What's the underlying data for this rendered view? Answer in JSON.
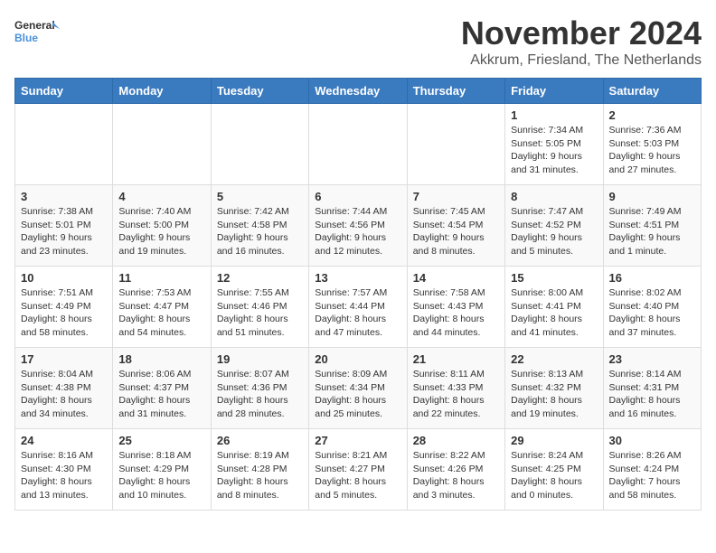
{
  "header": {
    "logo_general": "General",
    "logo_blue": "Blue",
    "month_year": "November 2024",
    "location": "Akkrum, Friesland, The Netherlands"
  },
  "weekdays": [
    "Sunday",
    "Monday",
    "Tuesday",
    "Wednesday",
    "Thursday",
    "Friday",
    "Saturday"
  ],
  "weeks": [
    [
      {
        "day": "",
        "info": ""
      },
      {
        "day": "",
        "info": ""
      },
      {
        "day": "",
        "info": ""
      },
      {
        "day": "",
        "info": ""
      },
      {
        "day": "",
        "info": ""
      },
      {
        "day": "1",
        "info": "Sunrise: 7:34 AM\nSunset: 5:05 PM\nDaylight: 9 hours and 31 minutes."
      },
      {
        "day": "2",
        "info": "Sunrise: 7:36 AM\nSunset: 5:03 PM\nDaylight: 9 hours and 27 minutes."
      }
    ],
    [
      {
        "day": "3",
        "info": "Sunrise: 7:38 AM\nSunset: 5:01 PM\nDaylight: 9 hours and 23 minutes."
      },
      {
        "day": "4",
        "info": "Sunrise: 7:40 AM\nSunset: 5:00 PM\nDaylight: 9 hours and 19 minutes."
      },
      {
        "day": "5",
        "info": "Sunrise: 7:42 AM\nSunset: 4:58 PM\nDaylight: 9 hours and 16 minutes."
      },
      {
        "day": "6",
        "info": "Sunrise: 7:44 AM\nSunset: 4:56 PM\nDaylight: 9 hours and 12 minutes."
      },
      {
        "day": "7",
        "info": "Sunrise: 7:45 AM\nSunset: 4:54 PM\nDaylight: 9 hours and 8 minutes."
      },
      {
        "day": "8",
        "info": "Sunrise: 7:47 AM\nSunset: 4:52 PM\nDaylight: 9 hours and 5 minutes."
      },
      {
        "day": "9",
        "info": "Sunrise: 7:49 AM\nSunset: 4:51 PM\nDaylight: 9 hours and 1 minute."
      }
    ],
    [
      {
        "day": "10",
        "info": "Sunrise: 7:51 AM\nSunset: 4:49 PM\nDaylight: 8 hours and 58 minutes."
      },
      {
        "day": "11",
        "info": "Sunrise: 7:53 AM\nSunset: 4:47 PM\nDaylight: 8 hours and 54 minutes."
      },
      {
        "day": "12",
        "info": "Sunrise: 7:55 AM\nSunset: 4:46 PM\nDaylight: 8 hours and 51 minutes."
      },
      {
        "day": "13",
        "info": "Sunrise: 7:57 AM\nSunset: 4:44 PM\nDaylight: 8 hours and 47 minutes."
      },
      {
        "day": "14",
        "info": "Sunrise: 7:58 AM\nSunset: 4:43 PM\nDaylight: 8 hours and 44 minutes."
      },
      {
        "day": "15",
        "info": "Sunrise: 8:00 AM\nSunset: 4:41 PM\nDaylight: 8 hours and 41 minutes."
      },
      {
        "day": "16",
        "info": "Sunrise: 8:02 AM\nSunset: 4:40 PM\nDaylight: 8 hours and 37 minutes."
      }
    ],
    [
      {
        "day": "17",
        "info": "Sunrise: 8:04 AM\nSunset: 4:38 PM\nDaylight: 8 hours and 34 minutes."
      },
      {
        "day": "18",
        "info": "Sunrise: 8:06 AM\nSunset: 4:37 PM\nDaylight: 8 hours and 31 minutes."
      },
      {
        "day": "19",
        "info": "Sunrise: 8:07 AM\nSunset: 4:36 PM\nDaylight: 8 hours and 28 minutes."
      },
      {
        "day": "20",
        "info": "Sunrise: 8:09 AM\nSunset: 4:34 PM\nDaylight: 8 hours and 25 minutes."
      },
      {
        "day": "21",
        "info": "Sunrise: 8:11 AM\nSunset: 4:33 PM\nDaylight: 8 hours and 22 minutes."
      },
      {
        "day": "22",
        "info": "Sunrise: 8:13 AM\nSunset: 4:32 PM\nDaylight: 8 hours and 19 minutes."
      },
      {
        "day": "23",
        "info": "Sunrise: 8:14 AM\nSunset: 4:31 PM\nDaylight: 8 hours and 16 minutes."
      }
    ],
    [
      {
        "day": "24",
        "info": "Sunrise: 8:16 AM\nSunset: 4:30 PM\nDaylight: 8 hours and 13 minutes."
      },
      {
        "day": "25",
        "info": "Sunrise: 8:18 AM\nSunset: 4:29 PM\nDaylight: 8 hours and 10 minutes."
      },
      {
        "day": "26",
        "info": "Sunrise: 8:19 AM\nSunset: 4:28 PM\nDaylight: 8 hours and 8 minutes."
      },
      {
        "day": "27",
        "info": "Sunrise: 8:21 AM\nSunset: 4:27 PM\nDaylight: 8 hours and 5 minutes."
      },
      {
        "day": "28",
        "info": "Sunrise: 8:22 AM\nSunset: 4:26 PM\nDaylight: 8 hours and 3 minutes."
      },
      {
        "day": "29",
        "info": "Sunrise: 8:24 AM\nSunset: 4:25 PM\nDaylight: 8 hours and 0 minutes."
      },
      {
        "day": "30",
        "info": "Sunrise: 8:26 AM\nSunset: 4:24 PM\nDaylight: 7 hours and 58 minutes."
      }
    ]
  ]
}
